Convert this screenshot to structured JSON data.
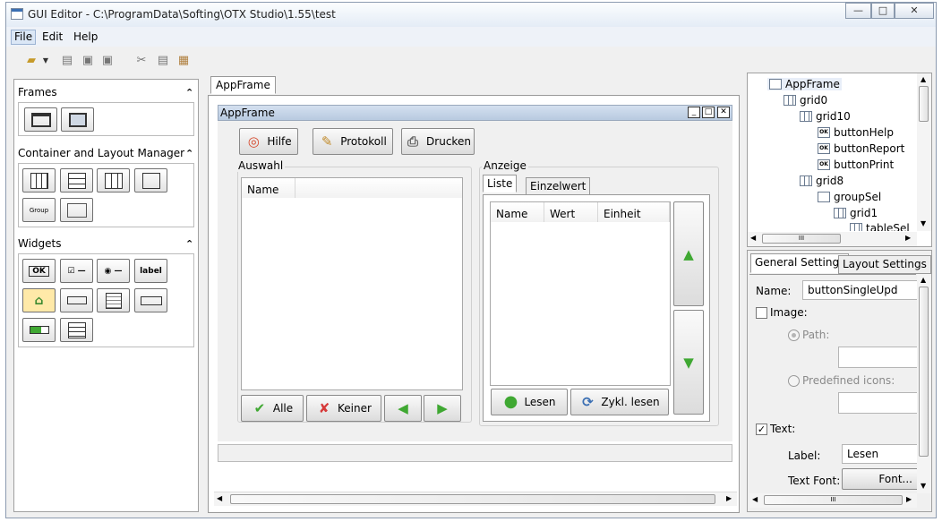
{
  "window": {
    "title": "GUI Editor - C:\\ProgramData\\Softing\\OTX Studio\\1.55\\test",
    "minimize": "—",
    "maximize": "□",
    "close": "✕"
  },
  "menu": [
    "File",
    "Edit",
    "Help"
  ],
  "palette": {
    "frames": {
      "title": "Frames"
    },
    "container": {
      "title": "Container and Layout Manager",
      "group_label": "Group"
    },
    "widgets": {
      "title": "Widgets",
      "ok_label": "OK",
      "label_label": "label"
    }
  },
  "editor": {
    "tab": "AppFrame",
    "frame_title": "AppFrame",
    "buttons": {
      "hilfe": "Hilfe",
      "protokoll": "Protokoll",
      "drucken": "Drucken"
    },
    "auswahl": {
      "title": "Auswahl",
      "column": "Name",
      "alle": "Alle",
      "keiner": "Keiner"
    },
    "anzeige": {
      "title": "Anzeige",
      "tabs": [
        "Liste",
        "Einzelwert"
      ],
      "columns": [
        "Name",
        "Wert",
        "Einheit"
      ],
      "lesen": "Lesen",
      "zykl": "Zykl. lesen"
    }
  },
  "tree": {
    "items": [
      {
        "label": "AppFrame",
        "icon": "frame-icon"
      },
      {
        "label": "grid0",
        "icon": "grid-icon"
      },
      {
        "label": "grid10",
        "icon": "grid-icon"
      },
      {
        "label": "buttonHelp",
        "icon": "button-icon"
      },
      {
        "label": "buttonReport",
        "icon": "button-icon"
      },
      {
        "label": "buttonPrint",
        "icon": "button-icon"
      },
      {
        "label": "grid8",
        "icon": "grid-icon"
      },
      {
        "label": "groupSel",
        "icon": "group-icon"
      },
      {
        "label": "grid1",
        "icon": "grid-icon"
      },
      {
        "label": "tableSel",
        "icon": "table-icon"
      }
    ],
    "ok_badge": "OK",
    "hscroll": "III"
  },
  "props": {
    "tabs": [
      "General Settings",
      "Layout Settings"
    ],
    "name_label": "Name:",
    "name_value": "buttonSingleUpd",
    "image_label": "Image:",
    "path_label": "Path:",
    "predef_label": "Predefined icons:",
    "text_label": "Text:",
    "label_label": "Label:",
    "label_value": "Lesen",
    "font_label": "Text Font:",
    "font_button": "Font...",
    "vscroll": "III",
    "hscroll": "III"
  },
  "colors": {
    "accent": "#3b6fb3",
    "frame_title_bar": "#bccde3",
    "green": "#3fa832",
    "red": "#d63a3a"
  }
}
